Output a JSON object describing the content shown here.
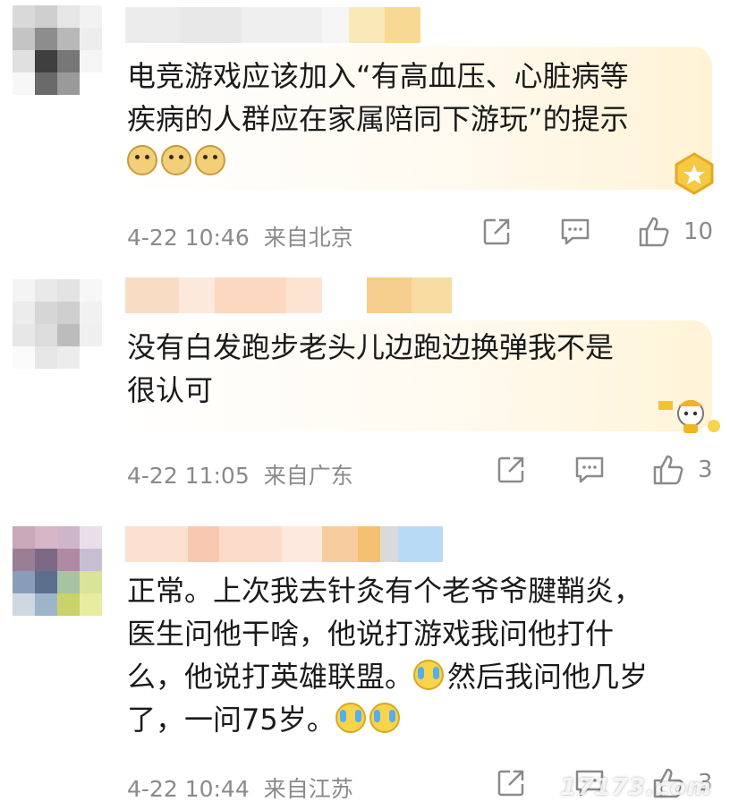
{
  "comments": [
    {
      "text_line1": "电竞游戏应该加入“有高血压、心脏病等",
      "text_line2": "疾病的人群应在家属陪同下游玩”的提示",
      "emoji": [
        "doge",
        "doge",
        "doge"
      ],
      "timestamp": "4-22 10:46",
      "location": "来自北京",
      "likes": "10"
    },
    {
      "text_line1": "没有白发跑步老头儿边跑边换弹我不是",
      "text_line2": "很认可",
      "timestamp": "4-22 11:05",
      "location": "来自广东",
      "likes": "3"
    },
    {
      "text_line1": "正常。上次我去针灸有个老爷爷腱鞘炎，",
      "text_line2": "医生问他干啥，他说打游戏我问他打什",
      "text_line3": "么，他说打英雄联盟。",
      "text_line3b": "然后我问他几岁",
      "text_line4": "了，一问75岁。",
      "timestamp": "4-22 10:44",
      "location": "来自江苏",
      "likes": "3"
    }
  ],
  "watermark": "17173.com",
  "colors": {
    "meta": "#8a8a8a",
    "bubble1": "#fff8e6",
    "bubble2": "#fff9e8"
  },
  "icons": [
    "share-icon",
    "comment-icon",
    "like-icon"
  ]
}
